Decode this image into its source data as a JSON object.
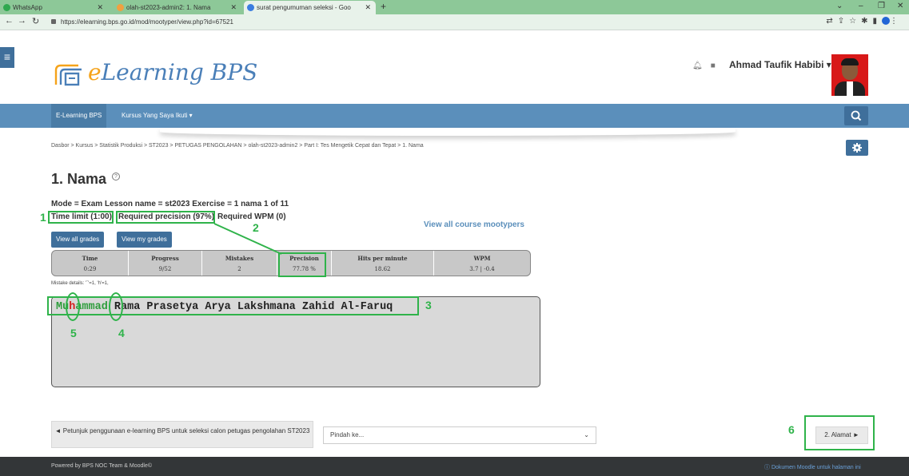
{
  "browser": {
    "tabs": [
      {
        "label": "WhatsApp",
        "icon": "whatsapp-icon"
      },
      {
        "label": "olah-st2023-admin2: 1. Nama",
        "icon": "moodle-icon"
      },
      {
        "label": "surat pengumuman seleksi - Goo",
        "icon": "google-icon"
      }
    ],
    "new_tab": "+",
    "url": "https://elearning.bps.go.id/mod/mootyper/view.php?id=67521"
  },
  "header": {
    "logo_e": "e",
    "logo_rest": "Learning BPS",
    "username": "Ahmad Taufik Habibi",
    "username_caret": "▾"
  },
  "navbar": {
    "home": "E-Learning BPS",
    "courses": "Kursus Yang Saya Ikuti ▾"
  },
  "breadcrumb": "Dasbor > Kursus > Statistik Produksi > ST2023 > PETUGAS PENGOLAHAN > olah-st2023-admin2 > Part I: Tes Mengetik Cepat dan Tepat > 1. Nama",
  "page": {
    "title": "1. Nama",
    "help": "?",
    "mode_line": "Mode = Exam   Lesson name = st2023   Exercise = 1 nama 1 of 11",
    "time_limit": "Time limit (1:00)",
    "required_precision": "Required precision (97%)",
    "required_wpm": "Required WPM (0)",
    "view_all_course": "View all course mootypers",
    "btn_view_all_grades": "View all grades",
    "btn_view_my_grades": "View my grades"
  },
  "stats": [
    {
      "label": "Time",
      "value": "0:29"
    },
    {
      "label": "Progress",
      "value": "9/52"
    },
    {
      "label": "Mistakes",
      "value": "2"
    },
    {
      "label": "Precision",
      "value": "77.78 %"
    },
    {
      "label": "Hits per minute",
      "value": "18.62"
    },
    {
      "label": "WPM",
      "value": "3.7 | -0.4"
    }
  ],
  "mistake_details": "Mistake details: '`'=1, 'h'=1,",
  "exercise_text": {
    "typed_ok_1": "Mu",
    "typed_err_1": "h",
    "typed_ok_2": "ammad ",
    "current": "R",
    "remaining": "ama Prasetya Arya Lakshmana Zahid Al-Faruq"
  },
  "activity_nav": {
    "prev": "◄ Petunjuk penggunaan e-learning BPS untuk seleksi calon petugas pengolahan ST2023",
    "jump_placeholder": "Pindah ke...",
    "next": "2. Alamat ►"
  },
  "footer": {
    "left": "Powered by BPS NOC Team & Moodle©",
    "right": "Dokumen Moodle untuk halaman ini"
  },
  "annotations": [
    "1",
    "2",
    "3",
    "4",
    "5",
    "6"
  ],
  "colors": {
    "navbar": "#5b8fbb",
    "button": "#3f6f9b",
    "annotation": "#2fb34a",
    "footer": "#333638"
  }
}
